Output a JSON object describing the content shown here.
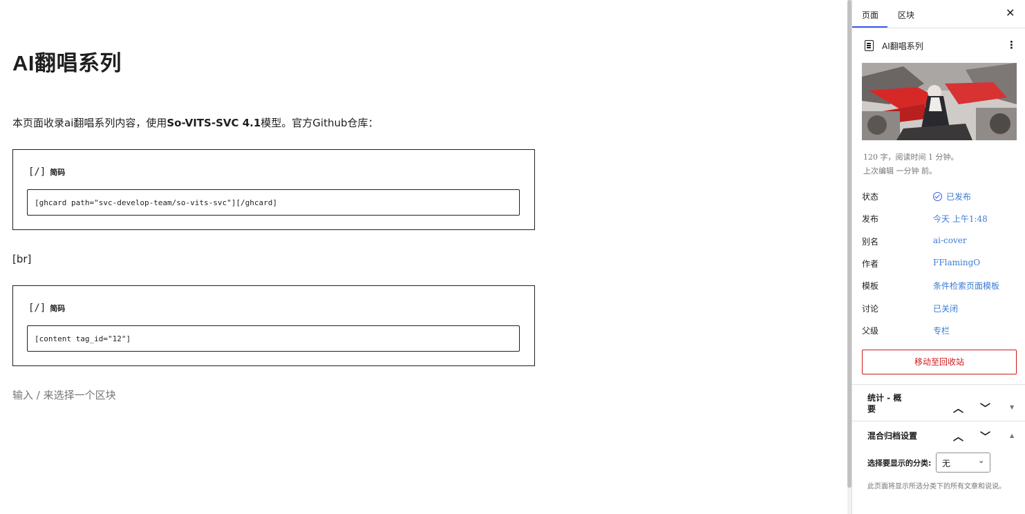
{
  "editor": {
    "title": "AI翻唱系列",
    "paragraph_prefix": "本页面收录ai翻唱系列内容，使用",
    "paragraph_bold": "So-VITS-SVC 4.1",
    "paragraph_suffix": "模型。官方Github仓库：",
    "shortcode_blocks": [
      {
        "icon": "[/]",
        "label": "简码",
        "value": "[ghcard path=\"svc-develop-team/so-vits-svc\"][/ghcard]"
      },
      {
        "icon": "[/]",
        "label": "简码",
        "value": "[content tag_id=\"12\"]"
      }
    ],
    "br_text": "[br]",
    "placeholder": "输入 / 来选择一个区块"
  },
  "sidebar": {
    "tabs": [
      "页面",
      "区块"
    ],
    "active_tab": "页面",
    "doc_title": "AI翻唱系列",
    "meta_words": "120 字，阅读时间 1 分钟。",
    "meta_edited": "上次编辑 一分钟 前。",
    "properties": [
      {
        "label": "状态",
        "value": "已发布"
      },
      {
        "label": "发布",
        "value": "今天 上午1:48"
      },
      {
        "label": "别名",
        "value": "ai-cover"
      },
      {
        "label": "作者",
        "value": "FFlamingO"
      },
      {
        "label": "模板",
        "value": "条件检索页面模板"
      },
      {
        "label": "讨论",
        "value": "已关闭"
      },
      {
        "label": "父级",
        "value": "专栏"
      }
    ],
    "trash_button": "移动至回收站",
    "panels": [
      {
        "title": "统计 - 概要",
        "expanded": false
      },
      {
        "title": "混合归档设置",
        "expanded": true
      }
    ],
    "category_label": "选择要显示的分类:",
    "category_value": "无",
    "help_text": "此页面将显示所选分类下的所有文章和说说。"
  },
  "colors": {
    "accent": "#3858e9",
    "link": "#3a7bd5",
    "danger": "#cc1818",
    "muted": "#757575"
  }
}
